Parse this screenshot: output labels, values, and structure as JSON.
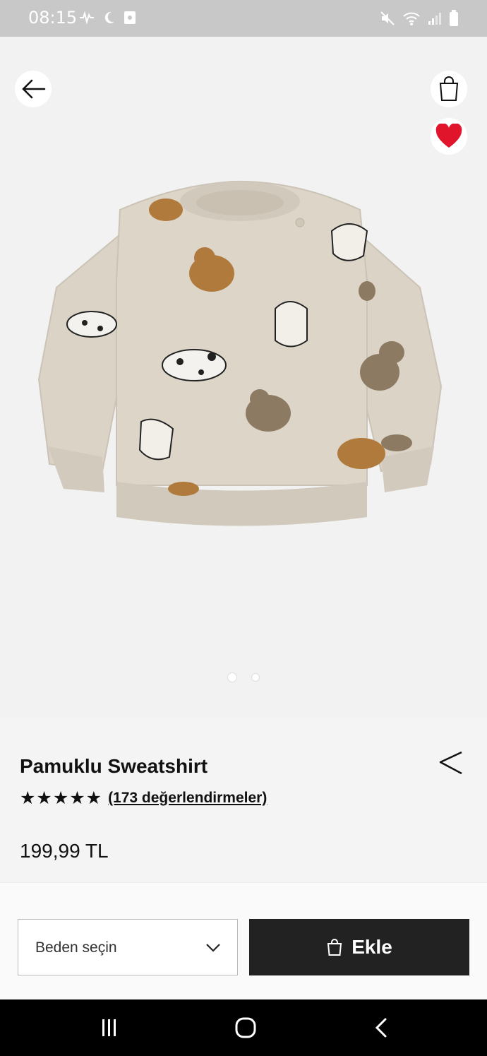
{
  "status": {
    "time": "08:15",
    "icons_left": [
      "pulse-icon",
      "moon-icon",
      "screenshot-icon"
    ],
    "icons_right": [
      "mute-icon",
      "wifi-icon",
      "signal-icon",
      "battery-icon"
    ]
  },
  "toolbar": {
    "back_icon": "arrow-left-icon",
    "bag_icon": "shopping-bag-icon",
    "favorite_icon": "heart-icon",
    "favorite_color": "#e0152b"
  },
  "gallery": {
    "image": "beige sweatshirt with bear and puppy print",
    "page_count": 2,
    "current_page": 1
  },
  "product": {
    "title": "Pamuklu Sweatshirt",
    "rating_stars": "★★★★★",
    "rating_value": 5,
    "reviews": "(173 değerlendirmeler)",
    "price": "199,99 TL"
  },
  "actions": {
    "size_placeholder": "Beden seçin",
    "add_label": "Ekle"
  },
  "navbar": {
    "items": [
      "recent-apps-icon",
      "home-icon",
      "back-icon"
    ]
  }
}
